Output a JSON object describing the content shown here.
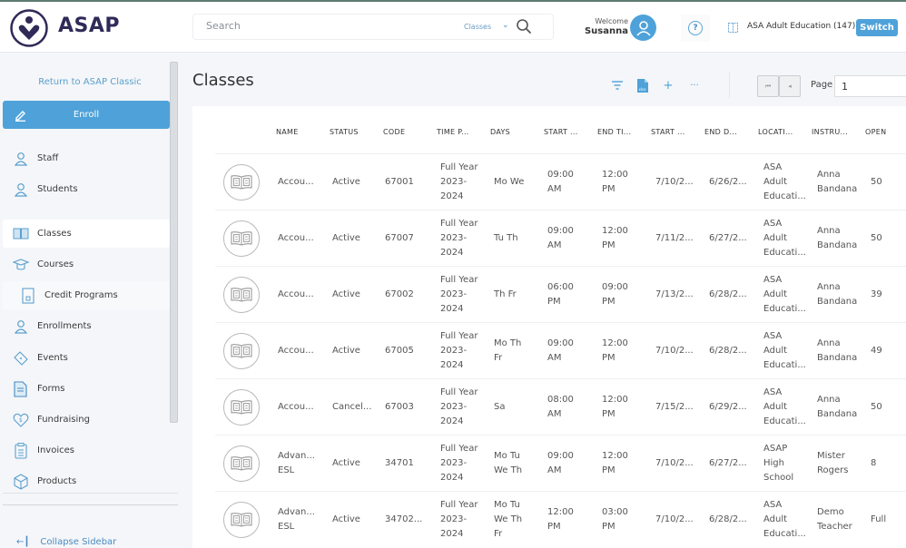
{
  "header": {
    "brand": "ASAP",
    "search": {
      "placeholder": "Search",
      "scope": "Classes"
    },
    "welcome": "Welcome",
    "user_name": "Susanna",
    "help_glyph": "?",
    "organization": "ASA Adult Education (147)",
    "switch_label": "Switch"
  },
  "sidebar": {
    "return_link": "Return to ASAP Classic",
    "enroll_label": "Enroll",
    "items": [
      {
        "label": "Staff",
        "icon": "staff-icon"
      },
      {
        "label": "Students",
        "icon": "user-icon"
      },
      {
        "label": "Classes",
        "icon": "book-icon",
        "active": true
      },
      {
        "label": "Courses",
        "icon": "graduation-cap-icon"
      },
      {
        "label": "Credit Programs",
        "icon": "document-icon",
        "sub": true
      },
      {
        "label": "Enrollments",
        "icon": "user-icon"
      },
      {
        "label": "Events",
        "icon": "ticket-icon"
      },
      {
        "label": "Forms",
        "icon": "form-icon"
      },
      {
        "label": "Fundraising",
        "icon": "heart-dollar-icon"
      },
      {
        "label": "Invoices",
        "icon": "clipboard-icon"
      },
      {
        "label": "Products",
        "icon": "box-icon"
      }
    ],
    "collapse_label": "Collapse Sidebar"
  },
  "main": {
    "title": "Classes",
    "toolbar": {
      "filter": "filter-icon",
      "export": "xlsx-export-icon",
      "add": "+",
      "more": "···"
    },
    "pager": {
      "first": "⏮",
      "prev": "◂",
      "page_label": "Page",
      "page_value": "1"
    },
    "columns": [
      "NAME",
      "STATUS",
      "CODE",
      "TIME P...",
      "DAYS",
      "START ...",
      "END TI...",
      "START ...",
      "END D...",
      "LOCATI...",
      "INSTRU...",
      "OPEN"
    ],
    "rows": [
      {
        "name": [
          "Accou..."
        ],
        "status": "Active",
        "code": "67001",
        "time_period": [
          "Full Year",
          "2023-",
          "2024"
        ],
        "days": [
          "Mo We"
        ],
        "start_time": [
          "09:00",
          "AM"
        ],
        "end_time": [
          "12:00",
          "PM"
        ],
        "start_date": "7/10/2...",
        "end_date": "6/26/2...",
        "location": [
          "ASA",
          "Adult",
          "Educati..."
        ],
        "instructor": [
          "Anna",
          "Bandana"
        ],
        "open": "50"
      },
      {
        "name": [
          "Accou..."
        ],
        "status": "Active",
        "code": "67007",
        "time_period": [
          "Full Year",
          "2023-",
          "2024"
        ],
        "days": [
          "Tu Th"
        ],
        "start_time": [
          "09:00",
          "AM"
        ],
        "end_time": [
          "12:00",
          "PM"
        ],
        "start_date": "7/11/2...",
        "end_date": "6/27/2...",
        "location": [
          "ASA",
          "Adult",
          "Educati..."
        ],
        "instructor": [
          "Anna",
          "Bandana"
        ],
        "open": "50"
      },
      {
        "name": [
          "Accou..."
        ],
        "status": "Active",
        "code": "67002",
        "time_period": [
          "Full Year",
          "2023-",
          "2024"
        ],
        "days": [
          "Th Fr"
        ],
        "start_time": [
          "06:00",
          "PM"
        ],
        "end_time": [
          "09:00",
          "PM"
        ],
        "start_date": "7/13/2...",
        "end_date": "6/28/2...",
        "location": [
          "ASA",
          "Adult",
          "Educati..."
        ],
        "instructor": [
          "Anna",
          "Bandana"
        ],
        "open": "39"
      },
      {
        "name": [
          "Accou..."
        ],
        "status": "Active",
        "code": "67005",
        "time_period": [
          "Full Year",
          "2023-",
          "2024"
        ],
        "days": [
          "Mo Th",
          "Fr"
        ],
        "start_time": [
          "09:00",
          "AM"
        ],
        "end_time": [
          "12:00",
          "PM"
        ],
        "start_date": "7/10/2...",
        "end_date": "6/28/2...",
        "location": [
          "ASA",
          "Adult",
          "Educati..."
        ],
        "instructor": [
          "Anna",
          "Bandana"
        ],
        "open": "49"
      },
      {
        "name": [
          "Accou..."
        ],
        "status": "Cancel...",
        "code": "67003",
        "time_period": [
          "Full Year",
          "2023-",
          "2024"
        ],
        "days": [
          "Sa"
        ],
        "start_time": [
          "08:00",
          "AM"
        ],
        "end_time": [
          "12:00",
          "PM"
        ],
        "start_date": "7/15/2...",
        "end_date": "6/29/2...",
        "location": [
          "ASA",
          "Adult",
          "Educati..."
        ],
        "instructor": [
          "Anna",
          "Bandana"
        ],
        "open": "50"
      },
      {
        "name": [
          "Advan...",
          "ESL"
        ],
        "status": "Active",
        "code": "34701",
        "time_period": [
          "Full Year",
          "2023-",
          "2024"
        ],
        "days": [
          "Mo Tu",
          "We Th"
        ],
        "start_time": [
          "09:00",
          "AM"
        ],
        "end_time": [
          "12:00",
          "PM"
        ],
        "start_date": "7/10/2...",
        "end_date": "6/27/2...",
        "location": [
          "ASAP",
          "High",
          "School"
        ],
        "instructor": [
          "Mister",
          "Rogers"
        ],
        "open": "8"
      },
      {
        "name": [
          "Advan...",
          "ESL"
        ],
        "status": "Active",
        "code": "34702...",
        "time_period": [
          "Full Year",
          "2023-",
          "2024"
        ],
        "days": [
          "Mo Tu",
          "We Th",
          "Fr"
        ],
        "start_time": [
          "12:00",
          "PM"
        ],
        "end_time": [
          "03:00",
          "PM"
        ],
        "start_date": "7/10/2...",
        "end_date": "6/28/2...",
        "location": [
          "ASA",
          "Adult",
          "Educati..."
        ],
        "instructor": [
          "Demo",
          "Teacher"
        ],
        "open": "Full"
      }
    ]
  },
  "colors": {
    "accent": "#4ea2d9",
    "brand": "#2f2a57",
    "link": "#5ba0ce"
  }
}
